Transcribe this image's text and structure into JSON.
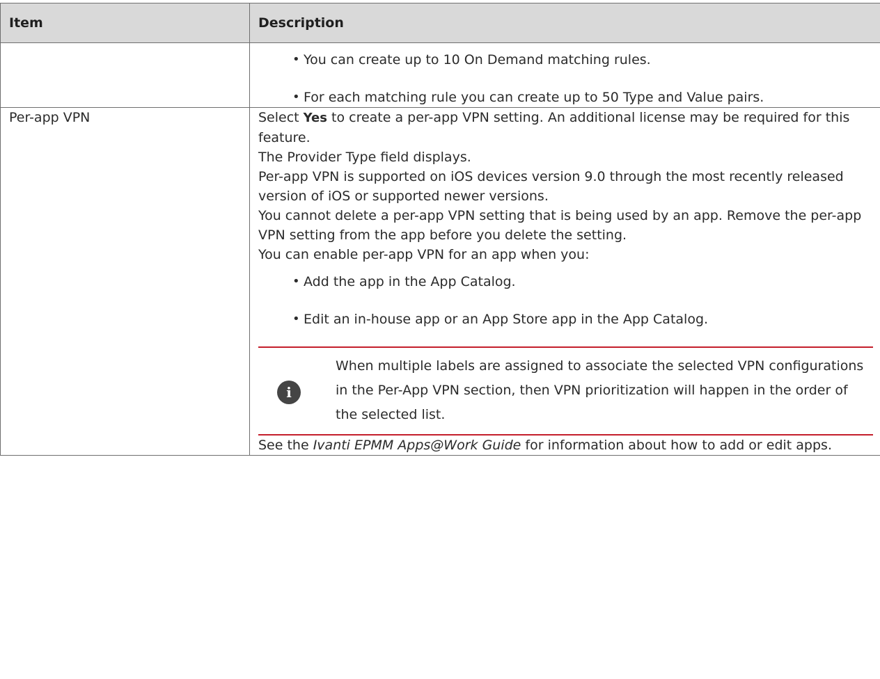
{
  "table": {
    "headers": {
      "item": "Item",
      "description": "Description"
    },
    "row1": {
      "item": "",
      "bullets": [
        "You can create up to 10 On Demand matching rules.",
        "For each matching rule you can create up to 50 Type and Value pairs."
      ]
    },
    "row2": {
      "item": "Per-app VPN",
      "select_pre": "Select ",
      "select_bold": "Yes",
      "select_post": " to create a per-app VPN setting. An additional license may be required for this feature.",
      "para2": "The Provider Type field displays.",
      "para3": "Per-app VPN is supported on iOS devices version 9.0 through the most recently released version of iOS or supported newer versions.",
      "para4": "You cannot delete a per-app VPN setting that is being used by an app. Remove the per-app VPN setting from the app before you delete the setting.",
      "para5": "You can enable per-app VPN for an app when you:",
      "bullets": [
        "Add the app in the App Catalog.",
        "Edit an in-house app or an App Store app in the App Catalog."
      ],
      "note": {
        "icon": "info-icon",
        "icon_glyph": "i",
        "text": "When multiple labels are assigned to associate the selected VPN configurations in the Per-App VPN section, then VPN prioritization will happen in the order of the selected list."
      },
      "see_pre": "See the ",
      "see_title": "Ivanti EPMM Apps@Work Guide",
      "see_post": " for information about how to add or edit apps."
    }
  },
  "colors": {
    "header_bg": "#d9d9d9",
    "note_rule": "#c41e2b",
    "info_icon": "#454545"
  }
}
